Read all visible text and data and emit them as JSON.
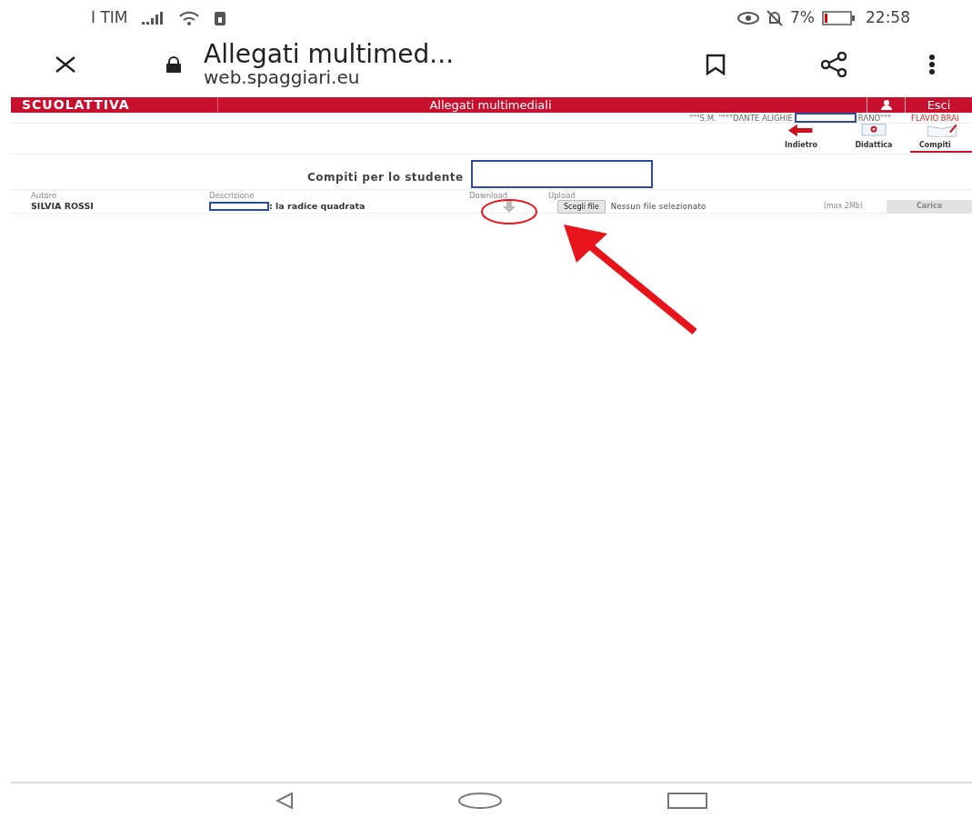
{
  "status_bar": {
    "carrier": "I TIM",
    "battery": "7%",
    "time": "22:58"
  },
  "browser_bar": {
    "title": "Allegati multimed...",
    "url": "web.spaggiari.eu"
  },
  "site_header": {
    "logo": "SCUOLATTIVA",
    "title": "Allegati multimediali",
    "logout": "Esci"
  },
  "school_line": {
    "school_start": "\"\"\"S.M. \"\"\"\"DANTE ALIGHIE",
    "school_end": "RANO\"\"\"",
    "user": "FLAVIO BRAI"
  },
  "toolbar": [
    {
      "kind": "back",
      "label": "Indietro",
      "selected": false
    },
    {
      "kind": "board",
      "label": "Didattica",
      "selected": false
    },
    {
      "kind": "book",
      "label": "Compiti",
      "selected": true
    }
  ],
  "heading": "Compiti per lo studente",
  "table": {
    "columns": [
      "Autore",
      "Descrizione",
      "Download",
      "Upload"
    ],
    "rows": [
      {
        "author": "SILVIA ROSSI",
        "description": ": la radice quadrata",
        "choose_button": "Scegli file",
        "file_status": "Nessun file selezionato",
        "limit": "(max 2Mb)",
        "upload_button": "Carica",
        "upload_disabled": true
      }
    ]
  }
}
